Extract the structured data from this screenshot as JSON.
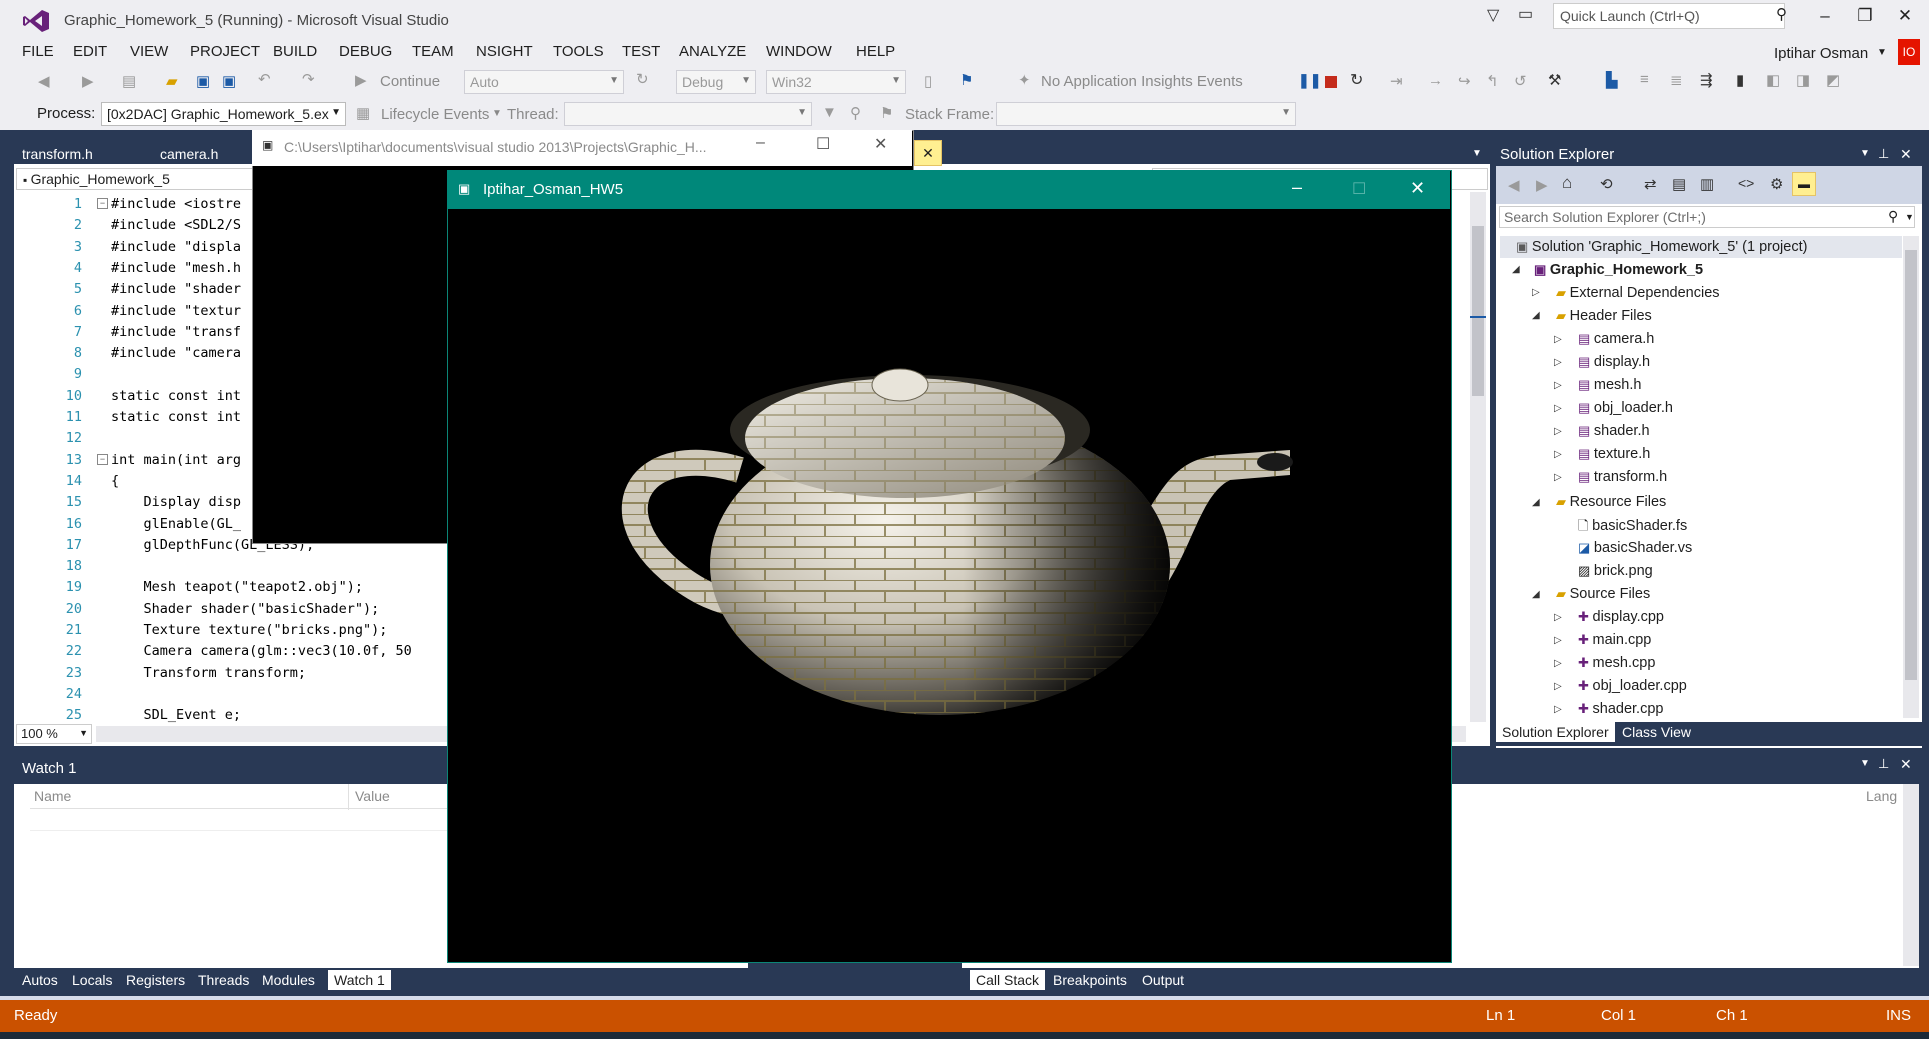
{
  "window": {
    "title": "Graphic_Homework_5 (Running) - Microsoft Visual Studio"
  },
  "quick_launch": {
    "placeholder": "Quick Launch (Ctrl+Q)"
  },
  "menu": [
    "FILE",
    "EDIT",
    "VIEW",
    "PROJECT",
    "BUILD",
    "DEBUG",
    "TEAM",
    "NSIGHT",
    "TOOLS",
    "TEST",
    "ANALYZE",
    "WINDOW",
    "HELP"
  ],
  "user": {
    "name": "Iptihar Osman",
    "initials": "IO"
  },
  "toolbar1": {
    "continue": "Continue",
    "solution_platform_auto": "Auto",
    "config": "Debug",
    "platform": "Win32",
    "insights": "No Application Insights Events"
  },
  "toolbar2": {
    "process_label": "Process:",
    "process_value": "[0x2DAC] Graphic_Homework_5.ex",
    "lifecycle": "Lifecycle Events",
    "thread_label": "Thread:",
    "stackframe_label": "Stack Frame:"
  },
  "editor": {
    "tabs": [
      "transform.h",
      "camera.h"
    ],
    "nav_scope": "Graphic_Homework_5",
    "zoom": "100 %",
    "lines": [
      {
        "n": "1",
        "t": "#include <iostre"
      },
      {
        "n": "2",
        "t": "#include <SDL2/S"
      },
      {
        "n": "3",
        "t": "#include \"displa"
      },
      {
        "n": "4",
        "t": "#include \"mesh.h"
      },
      {
        "n": "5",
        "t": "#include \"shader"
      },
      {
        "n": "6",
        "t": "#include \"textur"
      },
      {
        "n": "7",
        "t": "#include \"transf"
      },
      {
        "n": "8",
        "t": "#include \"camera"
      },
      {
        "n": "9",
        "t": ""
      },
      {
        "n": "10",
        "t": "static const int"
      },
      {
        "n": "11",
        "t": "static const int"
      },
      {
        "n": "12",
        "t": ""
      },
      {
        "n": "13",
        "t": "int main(int arg"
      },
      {
        "n": "14",
        "t": "{"
      },
      {
        "n": "15",
        "t": "    Display disp"
      },
      {
        "n": "16",
        "t": "    glEnable(GL_"
      },
      {
        "n": "17",
        "t": "    glDepthFunc(GL_LESS);"
      },
      {
        "n": "18",
        "t": ""
      },
      {
        "n": "19",
        "t": "    Mesh teapot(\"teapot2.obj\");"
      },
      {
        "n": "20",
        "t": "    Shader shader(\"basicShader\");"
      },
      {
        "n": "21",
        "t": "    Texture texture(\"bricks.png\");"
      },
      {
        "n": "22",
        "t": "    Camera camera(glm::vec3(10.0f, 50"
      },
      {
        "n": "23",
        "t": "    Transform transform;"
      },
      {
        "n": "24",
        "t": ""
      },
      {
        "n": "25",
        "t": "    SDL_Event e;"
      }
    ]
  },
  "console": {
    "title": "C:\\Users\\Iptihar\\documents\\visual studio 2013\\Projects\\Graphic_H..."
  },
  "glwindow": {
    "title": "Iptihar_Osman_HW5"
  },
  "watch": {
    "title": "Watch 1",
    "columns": [
      "Name",
      "Value"
    ],
    "lang_col": "Lang",
    "tabs": [
      "Autos",
      "Locals",
      "Registers",
      "Threads",
      "Modules",
      "Watch 1"
    ]
  },
  "callstack_tabs": [
    "Call Stack",
    "Breakpoints",
    "Output"
  ],
  "solution_explorer": {
    "title": "Solution Explorer",
    "search_placeholder": "Search Solution Explorer (Ctrl+;)",
    "solution": "Solution 'Graphic_Homework_5' (1 project)",
    "project": "Graphic_Homework_5",
    "external": "External Dependencies",
    "header_folder": "Header Files",
    "headers": [
      "camera.h",
      "display.h",
      "mesh.h",
      "obj_loader.h",
      "shader.h",
      "texture.h",
      "transform.h"
    ],
    "resource_folder": "Resource Files",
    "resources": [
      "basicShader.fs",
      "basicShader.vs",
      "brick.png"
    ],
    "source_folder": "Source Files",
    "sources": [
      "display.cpp",
      "main.cpp",
      "mesh.cpp",
      "obj_loader.cpp",
      "shader.cpp"
    ],
    "bottom_tabs": [
      "Solution Explorer",
      "Class View"
    ]
  },
  "status": {
    "ready": "Ready",
    "ln": "Ln 1",
    "col": "Col 1",
    "ch": "Ch 1",
    "ins": "INS"
  },
  "colors": {
    "status_bar": "#ca5100",
    "gl_title": "#00887a",
    "workspace": "#293955"
  }
}
